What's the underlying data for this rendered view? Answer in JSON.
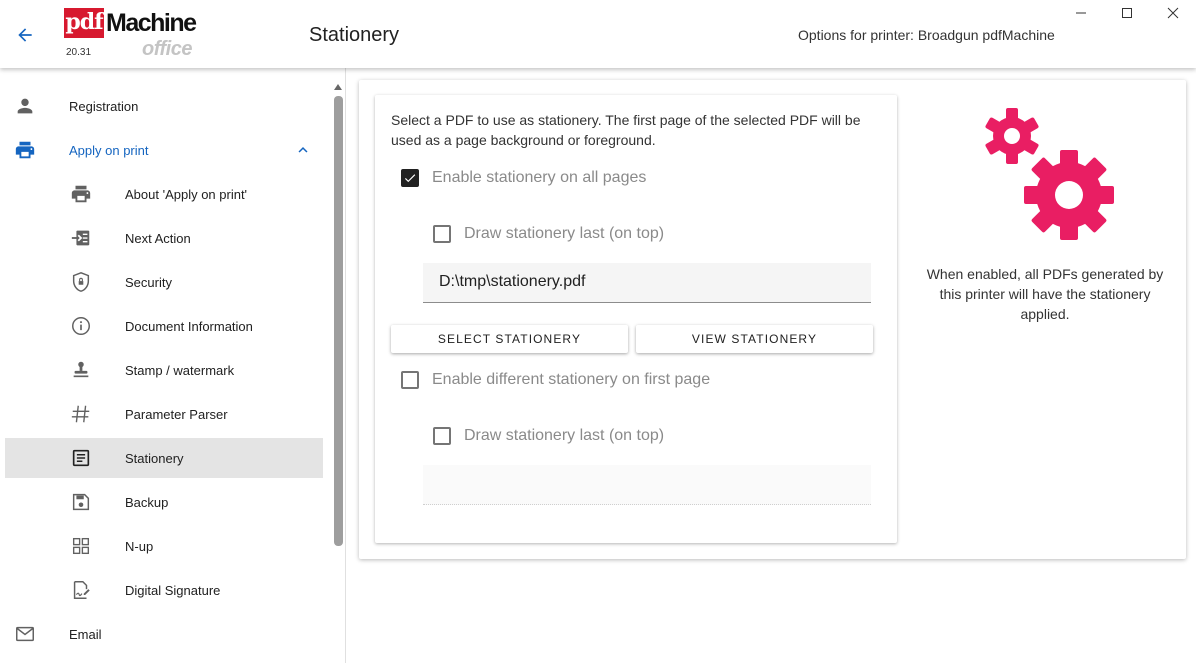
{
  "window": {
    "title": "Stationery",
    "printer_info": "Options for printer: Broadgun pdfMachine",
    "controls": {
      "minimize": "minimize-icon",
      "maximize": "maximize-icon",
      "close": "close-icon"
    }
  },
  "logo": {
    "pdf": "pdf",
    "machine": "Machine",
    "office": "office",
    "version": "20.31"
  },
  "sidebar": {
    "top_items": [
      {
        "label": "Registration",
        "icon": "person-icon"
      },
      {
        "label": "Apply on print",
        "icon": "printer-icon",
        "expanded": true
      },
      {
        "label": "Email",
        "icon": "mail-icon"
      }
    ],
    "sub_items": [
      {
        "label": "About 'Apply on print'",
        "icon": "printer-icon"
      },
      {
        "label": "Next Action",
        "icon": "next-action-icon"
      },
      {
        "label": "Security",
        "icon": "shield-icon"
      },
      {
        "label": "Document Information",
        "icon": "info-icon"
      },
      {
        "label": "Stamp / watermark",
        "icon": "stamp-icon"
      },
      {
        "label": "Parameter Parser",
        "icon": "hash-icon"
      },
      {
        "label": "Stationery",
        "icon": "document-icon",
        "selected": true
      },
      {
        "label": "Backup",
        "icon": "save-icon"
      },
      {
        "label": "N-up",
        "icon": "grid-icon"
      },
      {
        "label": "Digital Signature",
        "icon": "signature-icon"
      }
    ]
  },
  "stationery": {
    "description": "Select a PDF to use as stationery. The first page of the selected PDF will be used as a page background or foreground.",
    "enable_all": {
      "label": "Enable stationery on all pages",
      "checked": true
    },
    "draw_last_1": {
      "label": "Draw stationery last (on top)",
      "checked": false
    },
    "path_value": "D:\\tmp\\stationery.pdf",
    "select_button": "SELECT STATIONERY",
    "view_button": "VIEW STATIONERY",
    "enable_first": {
      "label": "Enable different stationery on first page",
      "checked": false
    },
    "draw_last_2": {
      "label": "Draw stationery last (on top)",
      "checked": false
    },
    "first_page_path": ""
  },
  "side_panel": {
    "icon": "gears-icon",
    "note": "When enabled, all PDFs generated by this printer will have the stationery applied."
  },
  "colors": {
    "accent": "#1565c0",
    "gear": "#e91e63",
    "logo_red": "#d7192f"
  }
}
